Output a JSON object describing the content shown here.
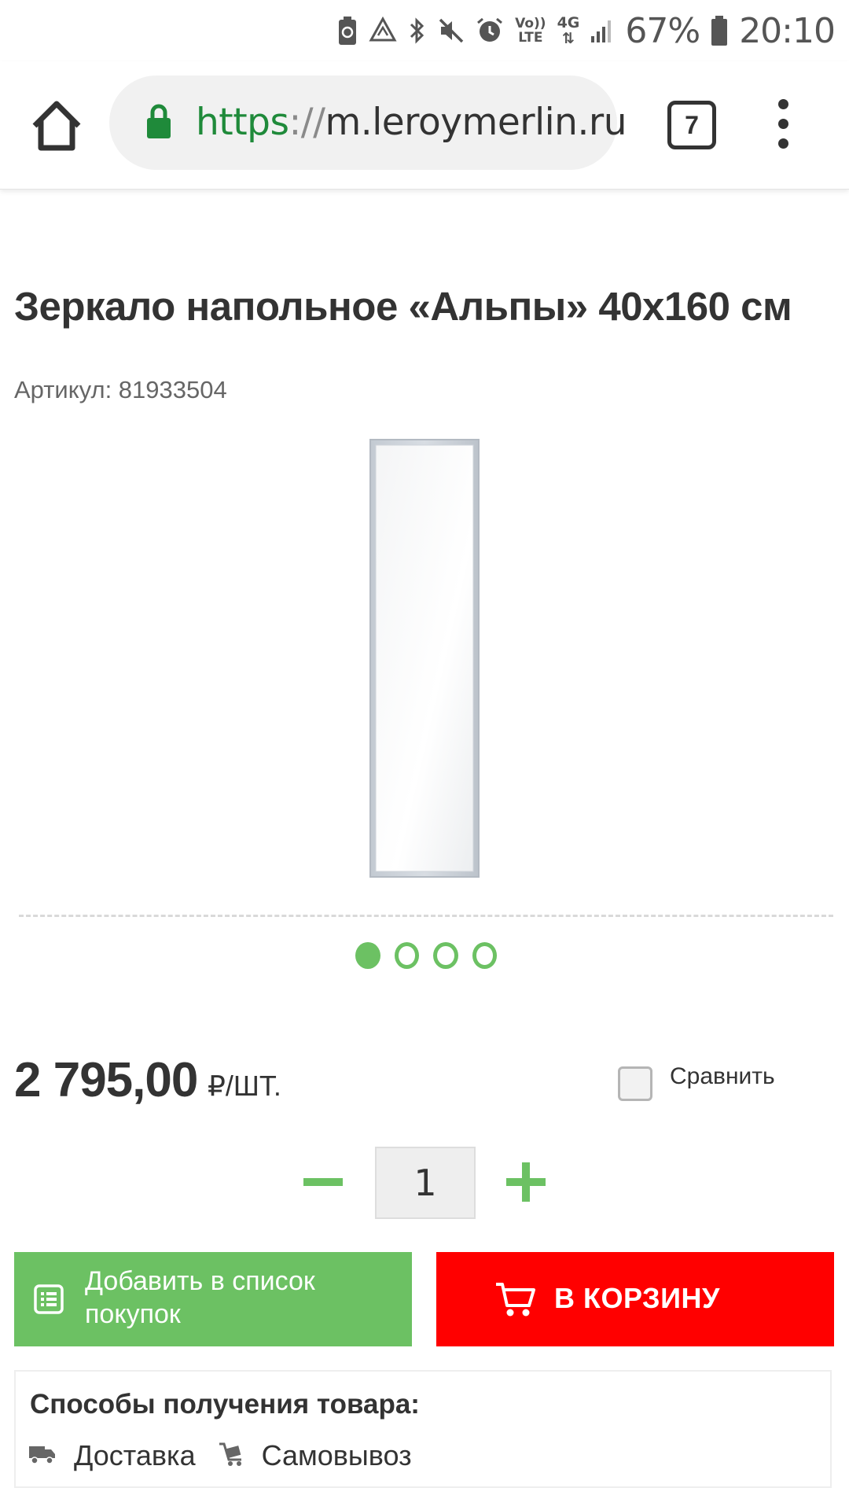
{
  "status_bar": {
    "battery_percent": "67%",
    "time": "20:10",
    "network": "4G",
    "volte_top": "Vo))",
    "volte_bottom": "LTE",
    "icons": [
      "battery-saver-icon",
      "data-saver-icon",
      "bluetooth-icon",
      "mute-icon",
      "alarm-icon",
      "volte-icon",
      "network-4g-icon",
      "signal-icon",
      "battery-icon"
    ]
  },
  "browser": {
    "url_scheme": "https",
    "url_separator": "://",
    "url_host": "m.leroymerlin.ru",
    "tab_count": "7",
    "icons": [
      "home-icon",
      "lock-icon",
      "menu-icon"
    ]
  },
  "product": {
    "title": "Зеркало напольное «Альпы» 40x160 см",
    "sku": "Артикул: 81933504",
    "image_name": "mirror-image",
    "gallery_total": 4,
    "gallery_active": 1,
    "price": "2 795,00",
    "price_unit": "₽/ШТ.",
    "compare_label": "Сравнить",
    "compare_checked": false,
    "quantity": "1"
  },
  "actions": {
    "add_to_list_label": "Добавить в список покупок",
    "add_to_cart_label": "В КОРЗИНУ"
  },
  "delivery": {
    "title": "Способы получения товара:",
    "options": [
      "Доставка",
      "Самовывоз"
    ]
  },
  "colors": {
    "brand_green": "#6cc163",
    "cart_red": "#ff0000",
    "secure_green": "#1f8a3a"
  }
}
